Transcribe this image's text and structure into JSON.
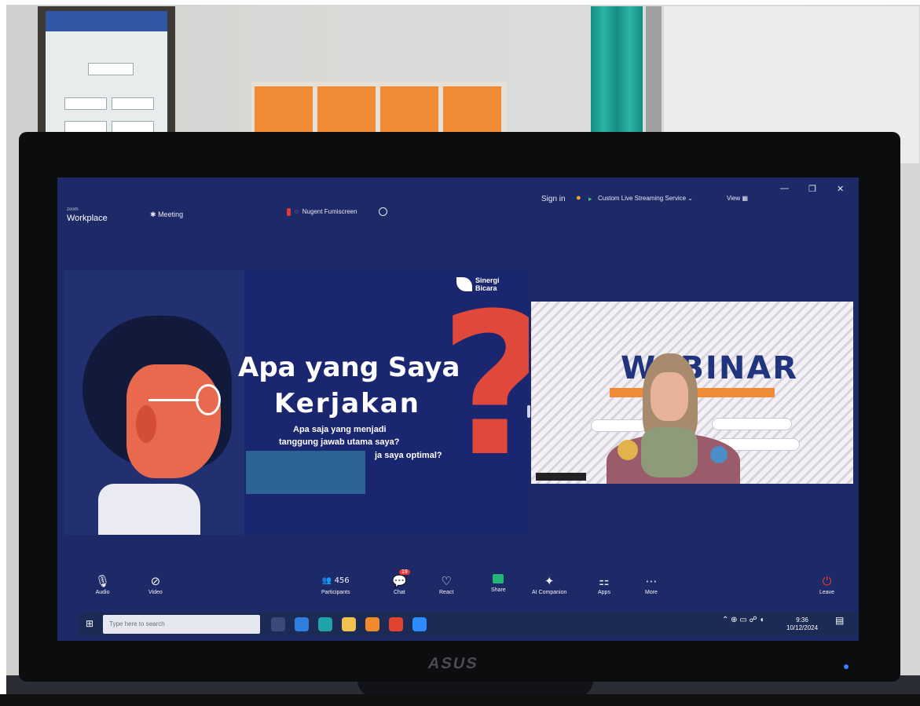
{
  "zoom": {
    "logo_small": "zoom",
    "logo_main": "Workplace",
    "meeting_label": "Meeting",
    "share_status": "Nugent Fumiscreen",
    "sign_in": "Sign in",
    "streaming": "Custom Live Streaming Service",
    "view": "View"
  },
  "slide": {
    "brand_line1": "Sinergi",
    "brand_line2": "Bicara",
    "title_line1": "Apa yang Saya",
    "title_line2": "Kerjakan",
    "sub_line1": "Apa saja yang menjadi",
    "sub_line2": "tanggung jawab utama saya?",
    "sub_line3": "ja saya optimal?"
  },
  "video": {
    "banner_text": "WEBINAR"
  },
  "toolbar": {
    "audio": "Audio",
    "video": "Video",
    "participants": "Participants",
    "participants_count": "456",
    "chat": "Chat",
    "chat_badge": "19",
    "react": "React",
    "share": "Share",
    "ai": "AI Companion",
    "apps": "Apps",
    "more": "More",
    "leave": "Leave"
  },
  "taskbar": {
    "search_placeholder": "Type here to search",
    "time": "9:36",
    "date": "10/12/2024"
  },
  "monitor": {
    "brand": "ASUS"
  }
}
